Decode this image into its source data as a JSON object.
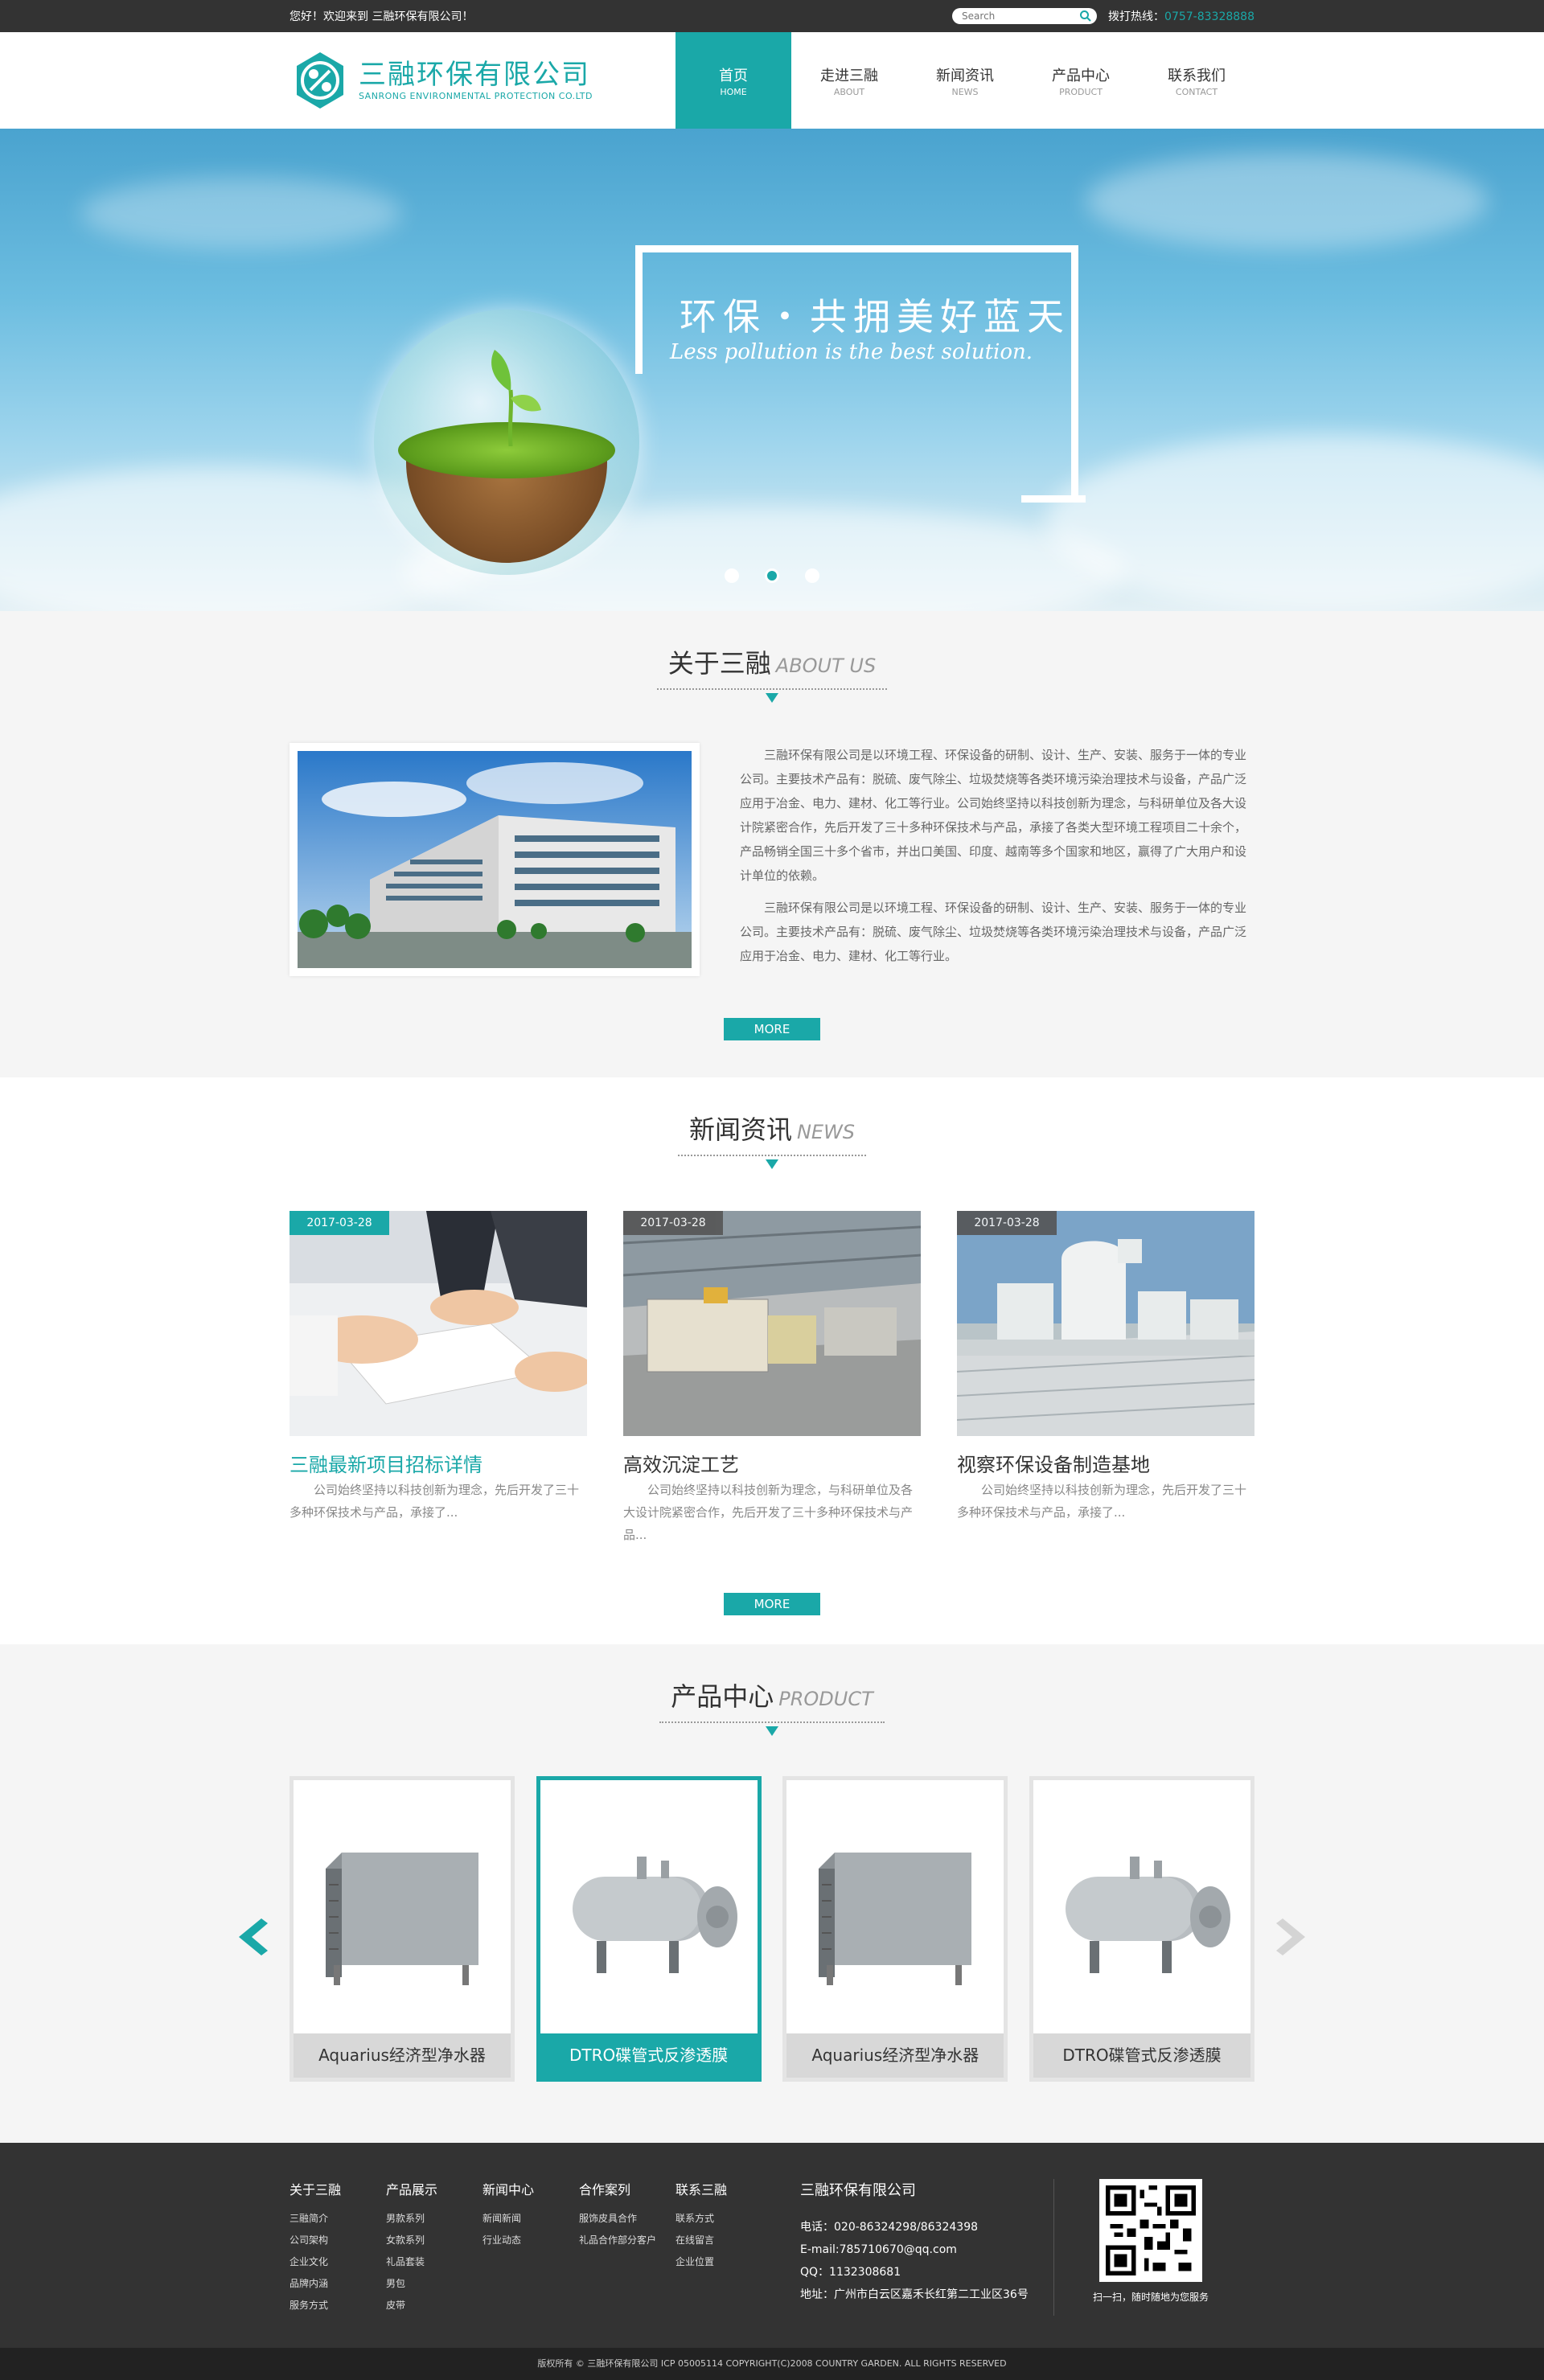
{
  "topbar": {
    "welcome": "您好！欢迎来到 三融环保有限公司！",
    "search_placeholder": "Search",
    "hotline_label": "拨打热线：",
    "hotline_number": "0757-83328888"
  },
  "logo": {
    "cn": "三融环保有限公司",
    "en": "SANRONG ENVIRONMENTAL PROTECTION CO.LTD"
  },
  "nav": [
    {
      "cn": "首页",
      "en": "HOME"
    },
    {
      "cn": "走进三融",
      "en": "ABOUT"
    },
    {
      "cn": "新闻资讯",
      "en": "NEWS"
    },
    {
      "cn": "产品中心",
      "en": "PRODUCT"
    },
    {
      "cn": "联系我们",
      "en": "CONTACT"
    }
  ],
  "banner": {
    "slogan_cn": "环保・共拥美好蓝天",
    "slogan_en": "Less pollution is the best solution.",
    "active_slide": 2,
    "slide_count": 3
  },
  "about": {
    "title_cn": "关于三融",
    "title_en": "ABOUT US",
    "para1": "三融环保有限公司是以环境工程、环保设备的研制、设计、生产、安装、服务于一体的专业公司。主要技术产品有：脱硫、废气除尘、垃圾焚烧等各类环境污染治理技术与设备，产品广泛应用于冶金、电力、建材、化工等行业。公司始终坚持以科技创新为理念，与科研单位及各大设计院紧密合作，先后开发了三十多种环保技术与产品，承接了各类大型环境工程项目二十余个，产品畅销全国三十多个省市，并出口美国、印度、越南等多个国家和地区，赢得了广大用户和设计单位的依赖。",
    "para2": "三融环保有限公司是以环境工程、环保设备的研制、设计、生产、安装、服务于一体的专业公司。主要技术产品有：脱硫、废气除尘、垃圾焚烧等各类环境污染治理技术与设备，产品广泛应用于冶金、电力、建材、化工等行业。",
    "more": "MORE"
  },
  "news": {
    "title_cn": "新闻资讯",
    "title_en": "NEWS",
    "items": [
      {
        "date": "2017-03-28",
        "title": "三融最新项目招标详情",
        "desc": "公司始终坚持以科技创新为理念，先后开发了三十多种环保技术与产品，承接了..."
      },
      {
        "date": "2017-03-28",
        "title": "高效沉淀工艺",
        "desc": "公司始终坚持以科技创新为理念，与科研单位及各大设计院紧密合作，先后开发了三十多种环保技术与产品..."
      },
      {
        "date": "2017-03-28",
        "title": "视察环保设备制造基地",
        "desc": "公司始终坚持以科技创新为理念，先后开发了三十多种环保技术与产品，承接了..."
      }
    ],
    "more": "MORE"
  },
  "products": {
    "title_cn": "产品中心",
    "title_en": "PRODUCT",
    "items": [
      {
        "name": "Aquarius经济型净水器"
      },
      {
        "name": "DTRO碟管式反渗透膜"
      },
      {
        "name": "Aquarius经济型净水器"
      },
      {
        "name": "DTRO碟管式反渗透膜"
      }
    ]
  },
  "footer": {
    "cols": [
      {
        "title": "关于三融",
        "links": [
          "三融简介",
          "公司架构",
          "企业文化",
          "品牌内涵",
          "服务方式"
        ]
      },
      {
        "title": "产品展示",
        "links": [
          "男款系列",
          "女款系列",
          "礼品套装",
          "男包",
          "皮带"
        ]
      },
      {
        "title": "新闻中心",
        "links": [
          "新闻新闻",
          "行业动态"
        ]
      },
      {
        "title": "合作案列",
        "links": [
          "服饰皮具合作",
          "礼品合作部分客户"
        ]
      },
      {
        "title": "联系三融",
        "links": [
          "联系方式",
          "在线留言",
          "企业位置"
        ]
      }
    ],
    "company": "三融环保有限公司",
    "phone": "电话：020-86324298/86324398",
    "email": "E-mail:785710670@qq.com",
    "qq": "QQ：1132308681",
    "address": "地址：广州市白云区嘉禾长红第二工业区36号",
    "qr_caption": "扫一扫，随时随地为您服务"
  },
  "copyright": "版权所有 © 三融环保有限公司 ICP 05005114 COPYRIGHT(C)2008 COUNTRY GARDEN. ALL RIGHTS RESERVED",
  "colors": {
    "accent": "#1aa8a8",
    "dark": "#333333"
  }
}
